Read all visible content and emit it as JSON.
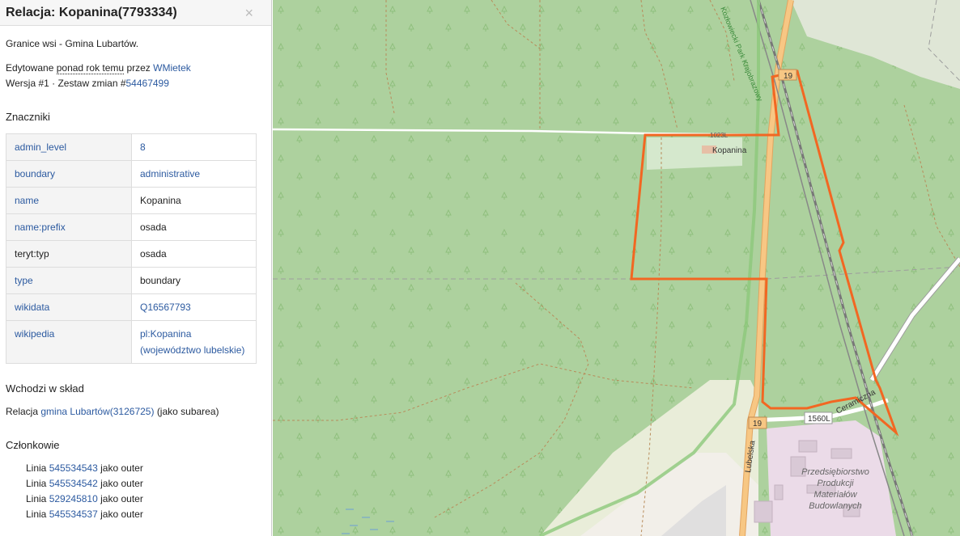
{
  "sidebar": {
    "title": "Relacja: Kopanina(7793334)",
    "close_glyph": "×",
    "description": "Granice wsi - Gmina Lubartów.",
    "edited_prefix": "Edytowane",
    "edited_time": "ponad rok temu",
    "edited_by": "przez",
    "edited_user": "WMietek",
    "version_text": "Wersja #1 · Zestaw zmian #",
    "changeset": "54467499",
    "tags_heading": "Znaczniki",
    "tags": [
      {
        "key": "admin_level",
        "value": "8",
        "key_link": true,
        "value_link": true
      },
      {
        "key": "boundary",
        "value": "administrative",
        "key_link": true,
        "value_link": true
      },
      {
        "key": "name",
        "value": "Kopanina",
        "key_link": true,
        "value_link": false
      },
      {
        "key": "name:prefix",
        "value": "osada",
        "key_link": true,
        "value_link": false
      },
      {
        "key": "teryt:typ",
        "value": "osada",
        "key_link": false,
        "value_link": false
      },
      {
        "key": "type",
        "value": "boundary",
        "key_link": true,
        "value_link": false
      },
      {
        "key": "wikidata",
        "value": "Q16567793",
        "key_link": true,
        "value_link": true
      },
      {
        "key": "wikipedia",
        "value": "pl:Kopanina (województwo lubelskie)",
        "key_link": true,
        "value_link": true
      }
    ],
    "part_of_heading": "Wchodzi w skład",
    "part_of_prefix": "Relacja",
    "part_of_link": "gmina Lubartów(3126725)",
    "part_of_suffix": "(jako subarea)",
    "members_heading": "Członkowie",
    "members": [
      {
        "type": "Linia",
        "id": "545534543",
        "role": "jako outer"
      },
      {
        "type": "Linia",
        "id": "545534542",
        "role": "jako outer"
      },
      {
        "type": "Linia",
        "id": "529245810",
        "role": "jako outer"
      },
      {
        "type": "Linia",
        "id": "545534537",
        "role": "jako outer"
      }
    ]
  },
  "map": {
    "labels": {
      "place": "Kopanina",
      "road_19_top": "19",
      "road_19_bottom": "19",
      "road_1560L": "1560L",
      "road_1023L": "1023L",
      "street_lubelska": "Lubelska",
      "street_ceramiczna": "Ceramiczna",
      "park": "Kozłowiecki Park Krajobrazowy",
      "factory_line1": "Przedsiębiorstwo",
      "factory_line2": "Produkcji",
      "factory_line3": "Materiałów",
      "factory_line4": "Budowlanych"
    },
    "colors": {
      "forest": "#add19e",
      "boundary": "#f26722",
      "road": "#f7c784",
      "industrial": "#ebdbe8"
    }
  }
}
